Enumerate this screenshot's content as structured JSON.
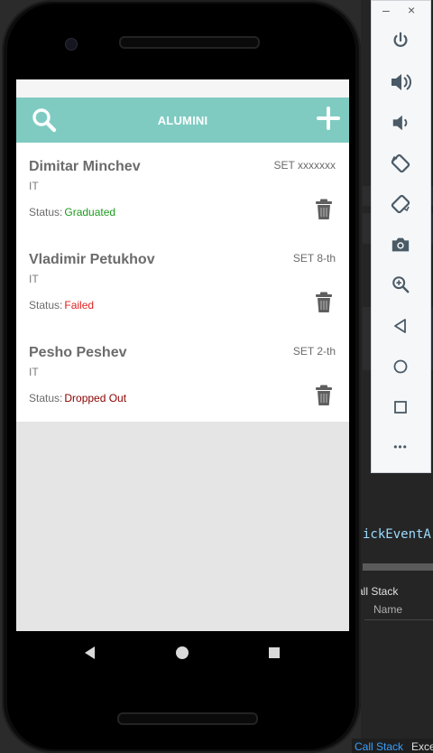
{
  "app": {
    "title": "ALUMINI",
    "search_icon": "search-icon",
    "add_icon": "plus-icon",
    "colors": {
      "app_bar": "#7fcbc2",
      "graduated": "#1e9a1e",
      "failed": "#e02020",
      "dropped": "#8b0000"
    }
  },
  "students": [
    {
      "name": "Dimitar Minchev",
      "dept": "IT",
      "set": "SET xxxxxxx",
      "status_label": "Status:",
      "status": "Graduated",
      "status_color": "#1e9a1e"
    },
    {
      "name": "Vladimir Petukhov",
      "dept": "IT",
      "set": "SET 8-th",
      "status_label": "Status:",
      "status": "Failed",
      "status_color": "#e02020"
    },
    {
      "name": "Pesho Peshev",
      "dept": "IT",
      "set": "SET 2-th",
      "status_label": "Status:",
      "status": "Dropped Out",
      "status_color": "#8b0000"
    }
  ],
  "nav": {
    "back_icon": "back-triangle-icon",
    "home_icon": "home-circle-icon",
    "recents_icon": "recents-square-icon"
  },
  "emulator_toolbar": {
    "minimize": "–",
    "close": "×",
    "buttons": [
      "power-icon",
      "volume-up-icon",
      "volume-down-icon",
      "rotate-left-icon",
      "rotate-right-icon",
      "camera-icon",
      "zoom-icon",
      "back-icon",
      "home-icon",
      "overview-icon",
      "more-icon"
    ],
    "more": "•••"
  },
  "ide": {
    "code_text": "ickEventA",
    "panel_title": "all Stack",
    "column_name": "Name",
    "tab_call_stack": "Call Stack",
    "tab_exceptions": "Exce"
  }
}
